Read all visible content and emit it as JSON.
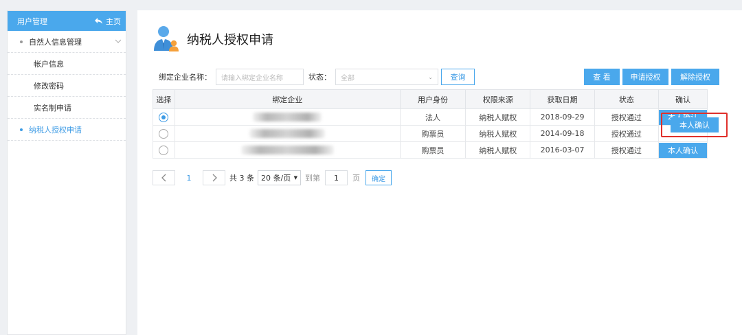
{
  "sidebar": {
    "title": "用户管理",
    "home_label": "主页",
    "items": [
      {
        "label": "自然人信息管理"
      },
      {
        "label": "帐户信息"
      },
      {
        "label": "修改密码"
      },
      {
        "label": "实名制申请"
      },
      {
        "label": "纳税人授权申请"
      }
    ]
  },
  "page": {
    "title": "纳税人授权申请"
  },
  "filter": {
    "company_label": "绑定企业名称：",
    "company_placeholder": "请输入绑定企业名称",
    "status_label": "状态：",
    "status_value": "全部",
    "search_label": "查询"
  },
  "actions": {
    "view": "查 看",
    "apply": "申请授权",
    "revoke": "解除授权"
  },
  "table": {
    "headers": [
      "选择",
      "绑定企业",
      "用户身份",
      "权限来源",
      "获取日期",
      "状态",
      "确认"
    ],
    "rows": [
      {
        "identity": "法人",
        "source": "纳税人赋权",
        "date": "2018-09-29",
        "status": "授权通过",
        "confirm": "本人确认"
      },
      {
        "identity": "购票员",
        "source": "纳税人赋权",
        "date": "2014-09-18",
        "status": "授权通过",
        "confirm": ""
      },
      {
        "identity": "购票员",
        "source": "纳税人赋权",
        "date": "2016-03-07",
        "status": "授权通过",
        "confirm": "本人确认"
      }
    ]
  },
  "pager": {
    "current": "1",
    "total": "共 3 条",
    "page_size": "20 条/页",
    "goto_label": "到第",
    "goto_value": "1",
    "page_suffix": "页",
    "ok_label": "确定"
  },
  "colors": {
    "accent": "#4aa8ec",
    "highlight": "#e0302b"
  }
}
